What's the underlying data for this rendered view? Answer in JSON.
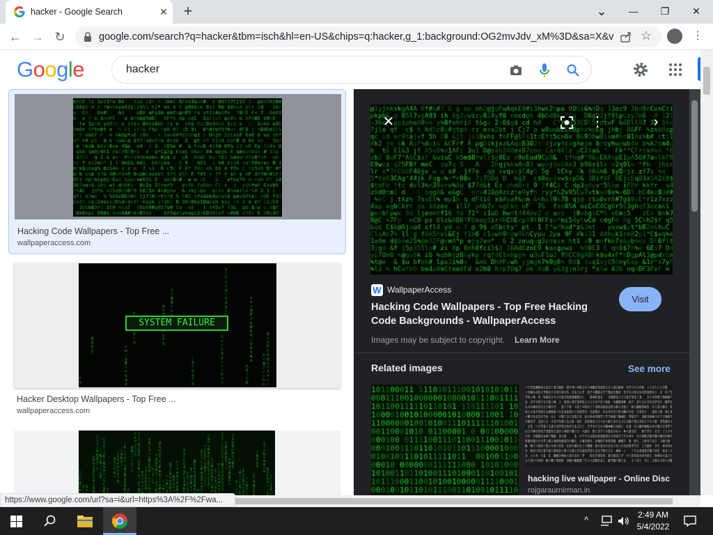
{
  "tab": {
    "title": "hacker - Google Search",
    "close": "✕",
    "new": "+"
  },
  "window": {
    "minimize": "—",
    "restore": "❐",
    "close": "✕",
    "dropdown": "⌄"
  },
  "toolbar": {
    "url": "google.com/search?q=hacker&tbm=isch&hl=en-US&chips=q:hacker,g_1:background:OG2mvJdv_xM%3D&sa=X&ve...",
    "back": "←",
    "forward": "→",
    "reload": "↻",
    "star": "☆",
    "menu": "⋮"
  },
  "google": {
    "logo": [
      {
        "ch": "G",
        "color": "#4285f4"
      },
      {
        "ch": "o",
        "color": "#ea4335"
      },
      {
        "ch": "o",
        "color": "#fbbc05"
      },
      {
        "ch": "g",
        "color": "#4285f4"
      },
      {
        "ch": "l",
        "color": "#34a853"
      },
      {
        "ch": "e",
        "color": "#ea4335"
      }
    ],
    "query": "hacker"
  },
  "results": [
    {
      "title": "Hacking Code Wallpapers - Top Free ...",
      "source": "wallpaperaccess.com"
    },
    {
      "title": "Hacker Desktop Wallpapers - Top Free ...",
      "source": "wallpaperaccess.com",
      "overlay": "SYSTEM FAILURE"
    },
    {
      "title": "",
      "source": ""
    }
  ],
  "preview": {
    "site_name": "WallpaperAccess",
    "site_letter": "W",
    "title": "Hacking Code Wallpapers - Top Free Hacking Code Backgrounds - WallpaperAccess",
    "visit_label": "Visit",
    "copyright": "Images may be subject to copyright.",
    "learn_more": "Learn More",
    "related_heading": "Related images",
    "see_more": "See more",
    "related": [
      {
        "title": "",
        "source": ""
      },
      {
        "title": "hacking live wallpaper - Online Disc...",
        "source": "rojgaraurnirman.in"
      }
    ]
  },
  "status_url": "https://www.google.com/url?sa=i&url=https%3A%2F%2Fwa...",
  "taskbar": {
    "time": "2:49 AM",
    "date": "5/4/2022"
  },
  "colors": {
    "matrix_green": "#1fd12a",
    "accent": "#1a73e8",
    "visit_btn": "#8ab4f8"
  }
}
